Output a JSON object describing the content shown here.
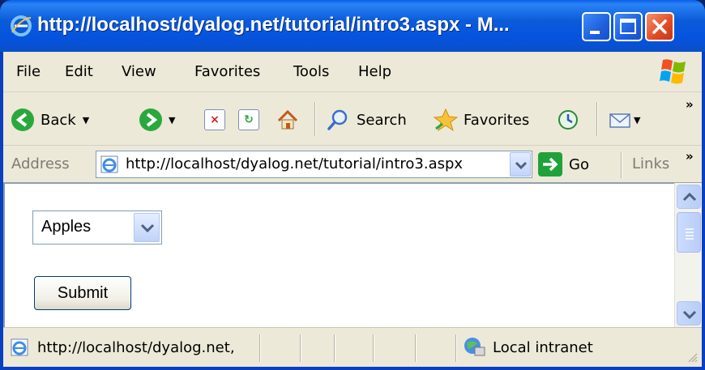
{
  "window": {
    "title": "http://localhost/dyalog.net/tutorial/intro3.aspx - M..."
  },
  "menu": {
    "items": [
      "File",
      "Edit",
      "View",
      "Favorites",
      "Tools",
      "Help"
    ]
  },
  "toolbar": {
    "back_label": "Back",
    "search_label": "Search",
    "favorites_label": "Favorites"
  },
  "address": {
    "label": "Address",
    "url": "http://localhost/dyalog.net/tutorial/intro3.aspx",
    "go_label": "Go",
    "links_label": "Links"
  },
  "page": {
    "select_value": "Apples",
    "submit_label": "Submit"
  },
  "status": {
    "url_text": "http://localhost/dyalog.net,",
    "zone": "Local intranet"
  },
  "colors": {
    "title_bar": "#0554e0",
    "chrome": "#ece9d8",
    "go_green": "#1fa23a"
  }
}
